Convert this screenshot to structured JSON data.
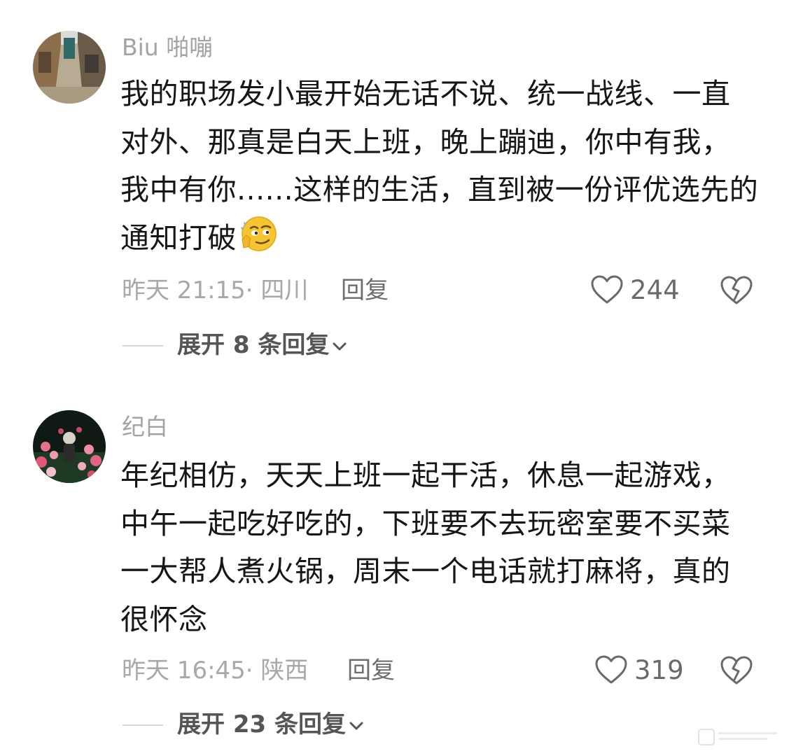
{
  "comments": [
    {
      "username": "Biu 啪嘣",
      "avatar_icon": "avatar-alley-photo",
      "text_lines": [
        "我的职场发小最开始无话不说、统一战线、一直",
        "对外、那真是白天上班，晚上蹦迪，你中有我，",
        "我中有你......这样的生活，直到被一份评优选先的",
        "通知打破"
      ],
      "emoji_icon": "thinking-smirk-emoji",
      "time_location": "昨天 21:15· 四川",
      "reply_label": "回复",
      "like_count": "244",
      "expand_label": "展开 8 条回复"
    },
    {
      "username": "纪白",
      "avatar_icon": "avatar-night-flowers-photo",
      "text_lines": [
        "年纪相仿，天天上班一起干活，休息一起游戏，",
        "中午一起吃好吃的，下班要不去玩密室要不买菜",
        "一大帮人煮火锅，周末一个电话就打麻将，真的",
        "很怀念"
      ],
      "time_location": "昨天 16:45· 陕西",
      "reply_label": "回复",
      "like_count": "319",
      "expand_label": "展开 23 条回复"
    }
  ],
  "colors": {
    "text": "#161616",
    "meta": "#a8a8a8",
    "icon": "#6a6a6a"
  }
}
